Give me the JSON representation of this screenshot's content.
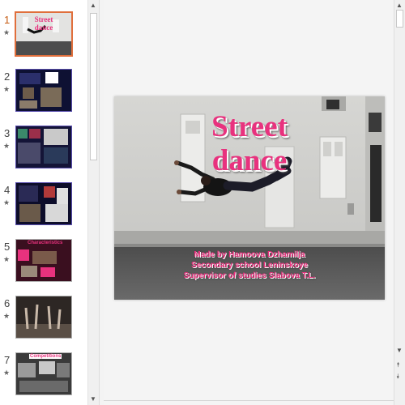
{
  "app": {
    "thumbnails": [
      {
        "num": "1",
        "star": "★",
        "selected": true,
        "title": "Street dance"
      },
      {
        "num": "2",
        "star": "★",
        "selected": false,
        "title": ""
      },
      {
        "num": "3",
        "star": "★",
        "selected": false,
        "title": ""
      },
      {
        "num": "4",
        "star": "★",
        "selected": false,
        "title": ""
      },
      {
        "num": "5",
        "star": "★",
        "selected": false,
        "title": "Characteristics"
      },
      {
        "num": "6",
        "star": "★",
        "selected": false,
        "title": ""
      },
      {
        "num": "7",
        "star": "★",
        "selected": false,
        "title": "Competitions"
      }
    ],
    "scroll_icons": {
      "up": "▲",
      "down": "▼",
      "page_up": "⯭",
      "page_down": "⯯"
    }
  },
  "slide": {
    "title_line1": "Street",
    "title_line2": "dance",
    "credit_line1": "Made by Hamoova Dzhamilja",
    "credit_line2": "Secondary school Leninskoye",
    "credit_line3": "Supervisor of studies Slabova T.L.",
    "accent_color": "#e8327e"
  },
  "thumb_slide1": {
    "title_line1": "Street",
    "title_line2": "dance"
  }
}
